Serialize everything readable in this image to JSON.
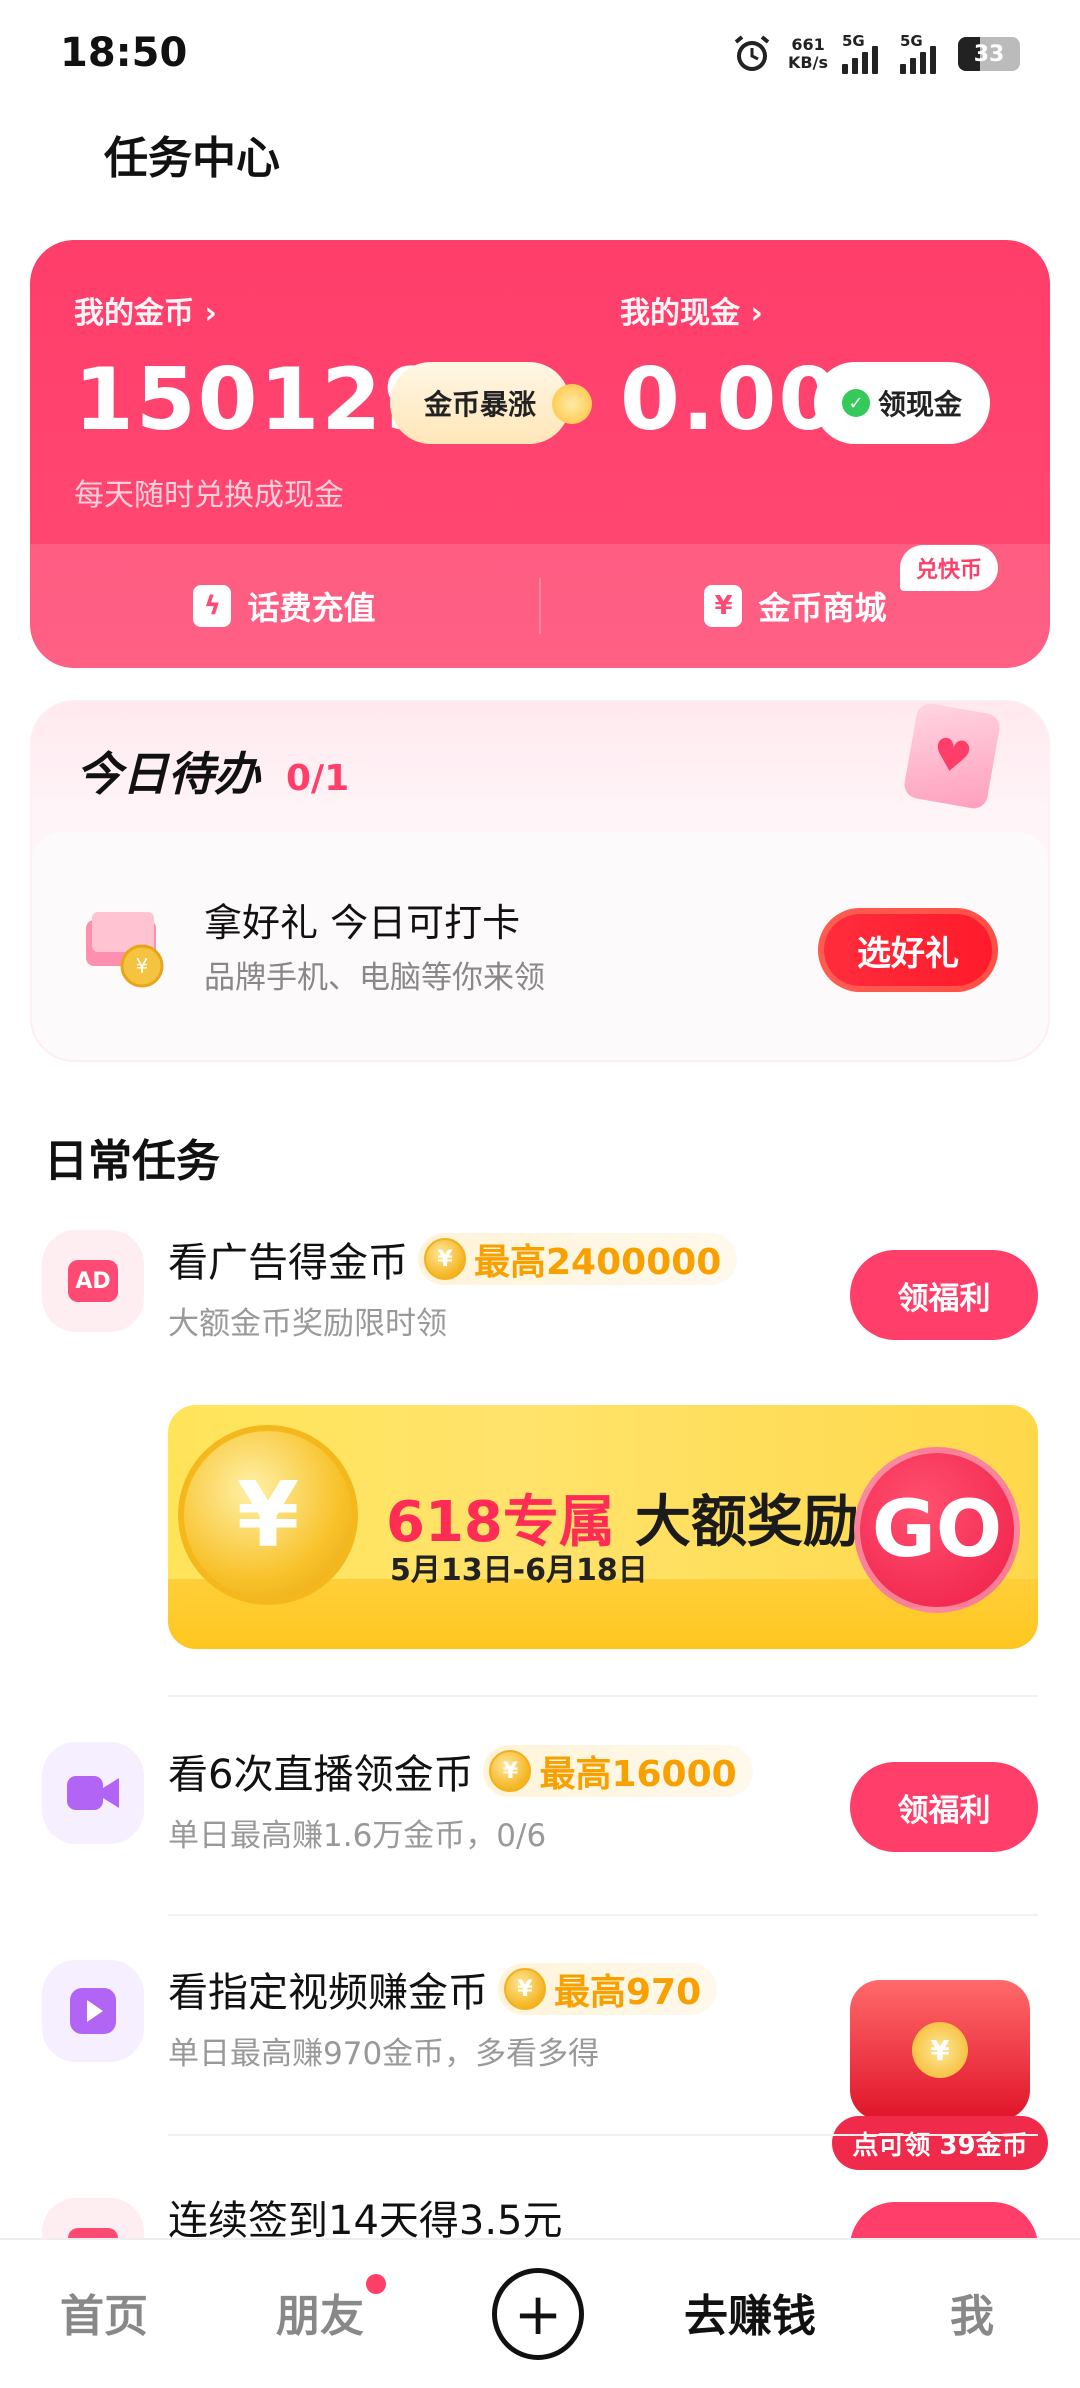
{
  "status_bar": {
    "time": "18:50",
    "net_speed_value": "661",
    "net_speed_unit": "KB/s",
    "signal1_label": "5G",
    "signal2_label": "5G",
    "battery": "33"
  },
  "header": {
    "title": "任务中心"
  },
  "wallet": {
    "coins_label": "我的金币 ›",
    "coins_value": "150129",
    "surge_label": "金币暴涨",
    "cash_label": "我的现金 ›",
    "cash_value": "0.00",
    "withdraw_label": "领现金",
    "subtitle": "每天随时兑换成现金",
    "recharge_label": "话费充值",
    "mall_label": "金币商城",
    "mall_badge": "兑快币",
    "accent_color": "#ff3e6a"
  },
  "todo": {
    "title": "今日待办",
    "count": "0/1",
    "item_title": "拿好礼 今日可打卡",
    "item_sub": "品牌手机、电脑等你来领",
    "button": "选好礼"
  },
  "daily": {
    "title": "日常任务",
    "tasks": [
      {
        "title": "看广告得金币",
        "reward": "最高2400000",
        "sub": "大额金币奖励限时领",
        "button": "领福利",
        "icon": "ad-icon"
      },
      {
        "title": "看6次直播领金币",
        "reward": "最高16000",
        "sub": "单日最高赚1.6万金币，0/6",
        "button": "领福利",
        "icon": "live-camera-icon"
      },
      {
        "title": "看指定视频赚金币",
        "reward": "最高970",
        "sub": "单日最高赚970金币，多看多得",
        "icon": "play-video-icon"
      },
      {
        "title": "连续签到14天得3.5元",
        "icon": "calendar-icon"
      }
    ],
    "promo": {
      "title_red": "618专属",
      "title_dark": "大额奖励",
      "date": "5月13日-6月18日",
      "go": "GO"
    },
    "chest_label": "点可领 39金币"
  },
  "bottom_nav": {
    "home": "首页",
    "friends": "朋友",
    "earn": "去赚钱",
    "me": "我",
    "plus": "+"
  }
}
